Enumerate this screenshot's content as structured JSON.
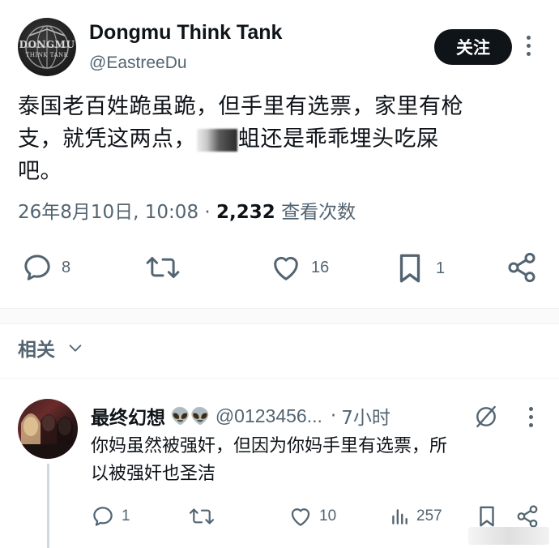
{
  "post": {
    "avatar_logo": "DONGMU",
    "avatar_sub": "THINK TANK",
    "display_name": "Dongmu Think Tank",
    "handle": "@EastreeDu",
    "follow_label": "关注",
    "text_line1": "泰国老百姓跪虽跪，但手里有选票，家里有枪",
    "text_line2_a": "支，就凭这两点，",
    "text_line2_b": "蛆还是乖乖埋头吃屎",
    "text_line3": "吧。",
    "timestamp": "26年8月10日, 10:08",
    "separator": "·",
    "view_count": "2,232",
    "view_label": "查看次数",
    "actions": {
      "reply": {
        "icon": "reply-icon",
        "count": "8"
      },
      "repost": {
        "icon": "repost-icon",
        "count": ""
      },
      "like": {
        "icon": "heart-icon",
        "count": "16"
      },
      "bookmark": {
        "icon": "bookmark-icon",
        "count": "1"
      },
      "share": {
        "icon": "share-icon",
        "count": ""
      }
    }
  },
  "related": {
    "label": "相关"
  },
  "reply": {
    "display_name": "最终幻想",
    "emojis": "👽👽",
    "handle": "@0123456...",
    "separator": "·",
    "time": "7小时",
    "text_line1": "你妈虽然被强奸，但因为你妈手里有选票，所",
    "text_line2": "以被强奸也圣洁",
    "actions": {
      "reply": {
        "icon": "reply-icon",
        "count": "1"
      },
      "repost": {
        "icon": "repost-icon",
        "count": ""
      },
      "like": {
        "icon": "heart-icon",
        "count": "10"
      },
      "views": {
        "icon": "bar-chart-icon",
        "count": "257"
      },
      "bookmark": {
        "icon": "bookmark-icon",
        "count": ""
      },
      "share": {
        "icon": "share-icon",
        "count": ""
      }
    }
  },
  "colors": {
    "text": "#0f1419",
    "secondary": "#536471",
    "divider": "#eff3f4",
    "follow_bg": "#0f1419"
  }
}
